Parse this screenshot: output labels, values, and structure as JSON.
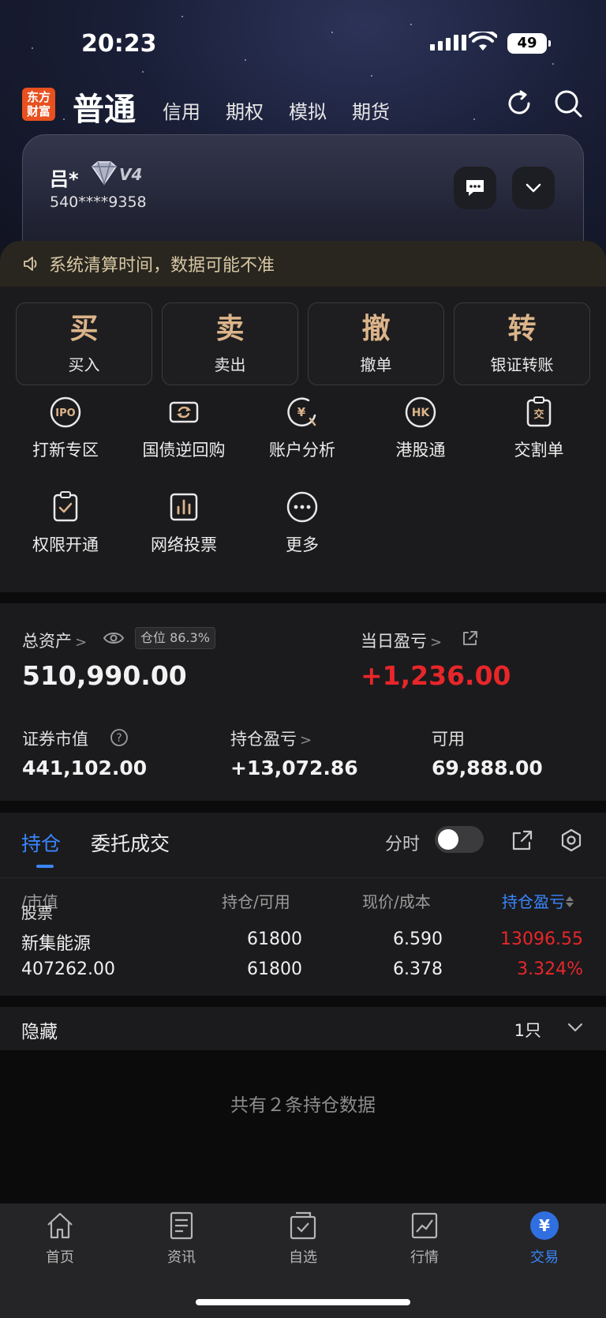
{
  "status": {
    "time": "20:23",
    "battery": "49"
  },
  "topnav": {
    "logo": [
      "东方",
      "财富"
    ],
    "main_tab": "普通",
    "tabs": [
      "信用",
      "期权",
      "模拟",
      "期货"
    ]
  },
  "account": {
    "name": "吕*",
    "level": "V4",
    "number": "540****9358"
  },
  "notice": "系统清算时间，数据可能不准",
  "big_buttons": [
    {
      "char": "买",
      "label": "买入"
    },
    {
      "char": "卖",
      "label": "卖出"
    },
    {
      "char": "撤",
      "label": "撤单"
    },
    {
      "char": "转",
      "label": "银证转账"
    }
  ],
  "grid": [
    {
      "icon": "ipo-icon",
      "label": "打新专区"
    },
    {
      "icon": "repo-icon",
      "label": "国债逆回购"
    },
    {
      "icon": "analysis-icon",
      "label": "账户分析"
    },
    {
      "icon": "hk-icon",
      "label": "港股通"
    },
    {
      "icon": "delivery-icon",
      "label": "交割单"
    },
    {
      "icon": "clipboard-check-icon",
      "label": "权限开通"
    },
    {
      "icon": "bar-chart-icon",
      "label": "网络投票"
    },
    {
      "icon": "more-icon",
      "label": "更多"
    }
  ],
  "assets": {
    "total_label": "总资产",
    "position_badge": "仓位 86.3%",
    "total_value": "510,990.00",
    "daily_label": "当日盈亏",
    "daily_value": "+1,236.00",
    "market_label": "证券市值",
    "market_value": "441,102.00",
    "hold_pl_label": "持仓盈亏",
    "hold_pl_value": "+13,072.86",
    "available_label": "可用",
    "available_value": "69,888.00"
  },
  "holdings": {
    "tabs": [
      "持仓",
      "委托成交"
    ],
    "toggle_label": "分时",
    "headers": {
      "stock": "股票",
      "stock_sub": "/市值",
      "qty": "持仓",
      "qty_sub": "/可用",
      "price": "现价",
      "price_sub": "/成本",
      "pl": "持仓盈亏"
    },
    "rows": [
      {
        "name": "新集能源",
        "market_value": "407262.00",
        "holding": "61800",
        "available": "61800",
        "price": "6.590",
        "cost": "6.378",
        "pl": "13096.55",
        "pl_pct": "3.324%"
      }
    ]
  },
  "hidden": {
    "label": "隐藏",
    "count": "1只"
  },
  "footer_msg": "共有２条持仓数据",
  "bottom_nav": [
    "首页",
    "资讯",
    "自选",
    "行情",
    "交易"
  ],
  "colors": {
    "accent": "#3a86ff",
    "loss_red": "#e8262a",
    "gold": "#dcb48a",
    "brand": "#e8501f"
  }
}
